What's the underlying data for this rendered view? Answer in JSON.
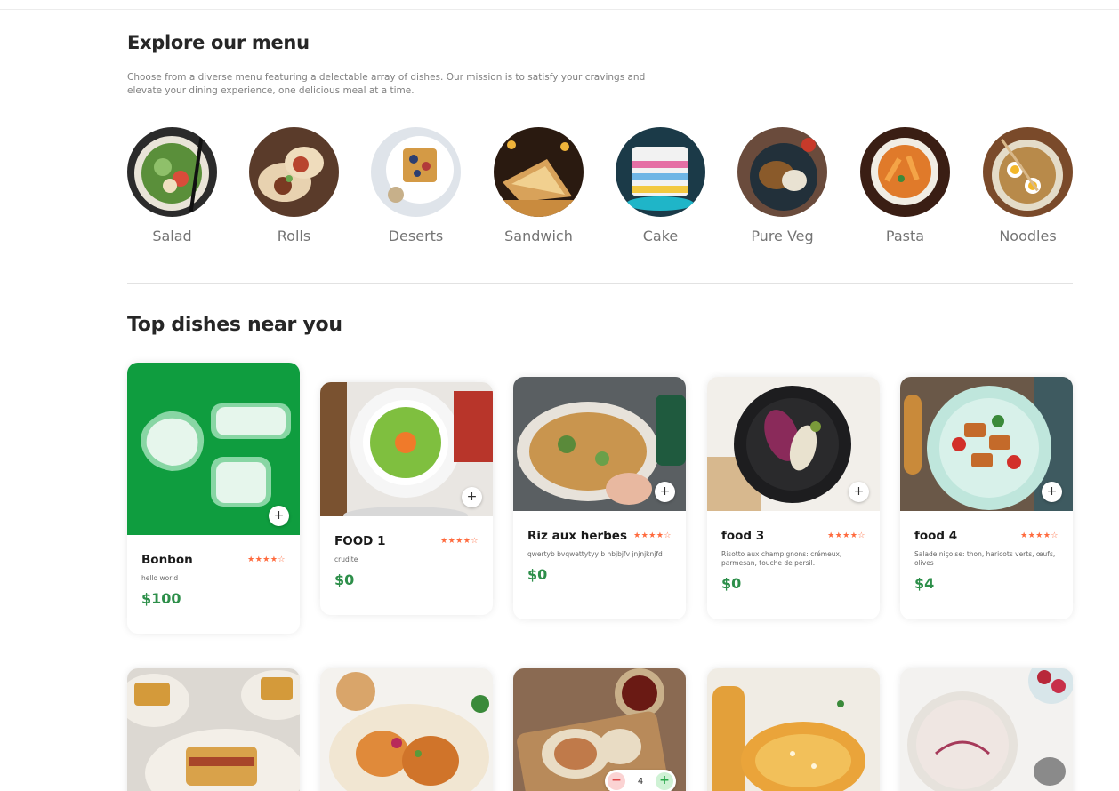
{
  "explore": {
    "title": "Explore our menu",
    "description": "Choose from a diverse menu featuring a delectable array of dishes. Our mission is to satisfy your cravings and elevate your dining experience, one delicious meal at a time."
  },
  "categories": [
    {
      "label": "Salad"
    },
    {
      "label": "Rolls"
    },
    {
      "label": "Deserts"
    },
    {
      "label": "Sandwich"
    },
    {
      "label": "Cake"
    },
    {
      "label": "Pure Veg"
    },
    {
      "label": "Pasta"
    },
    {
      "label": "Noodles"
    }
  ],
  "dishes": {
    "title": "Top dishes near you",
    "add_symbol": "+",
    "items": [
      {
        "name": "Bonbon",
        "stars": "★★★★☆",
        "rating": 4,
        "description": "hello world",
        "price": "$100"
      },
      {
        "name": "FOOD 1",
        "stars": "★★★★☆",
        "rating": 4,
        "description": "crudite",
        "price": "$0"
      },
      {
        "name": "Riz aux herbes",
        "stars": "★★★★☆",
        "rating": 4,
        "description": "qwertyb bvqwettytyy b hbjbjfv jnjnjknjfd",
        "price": "$0"
      },
      {
        "name": "food 3",
        "stars": "★★★★☆",
        "rating": 4,
        "description": "Risotto aux champignons: crémeux, parmesan, touche de persil.",
        "price": "$0"
      },
      {
        "name": "food 4",
        "stars": "★★★★☆",
        "rating": 4,
        "description": "Salade niçoise: thon, haricots verts, œufs, olives",
        "price": "$4"
      }
    ],
    "counter": {
      "minus": "−",
      "quantity": "4",
      "plus": "+"
    }
  },
  "colors": {
    "accent_green": "#2d8f4a",
    "star_orange": "#ff6a3d",
    "placeholder_green": "#0f9d3f"
  }
}
